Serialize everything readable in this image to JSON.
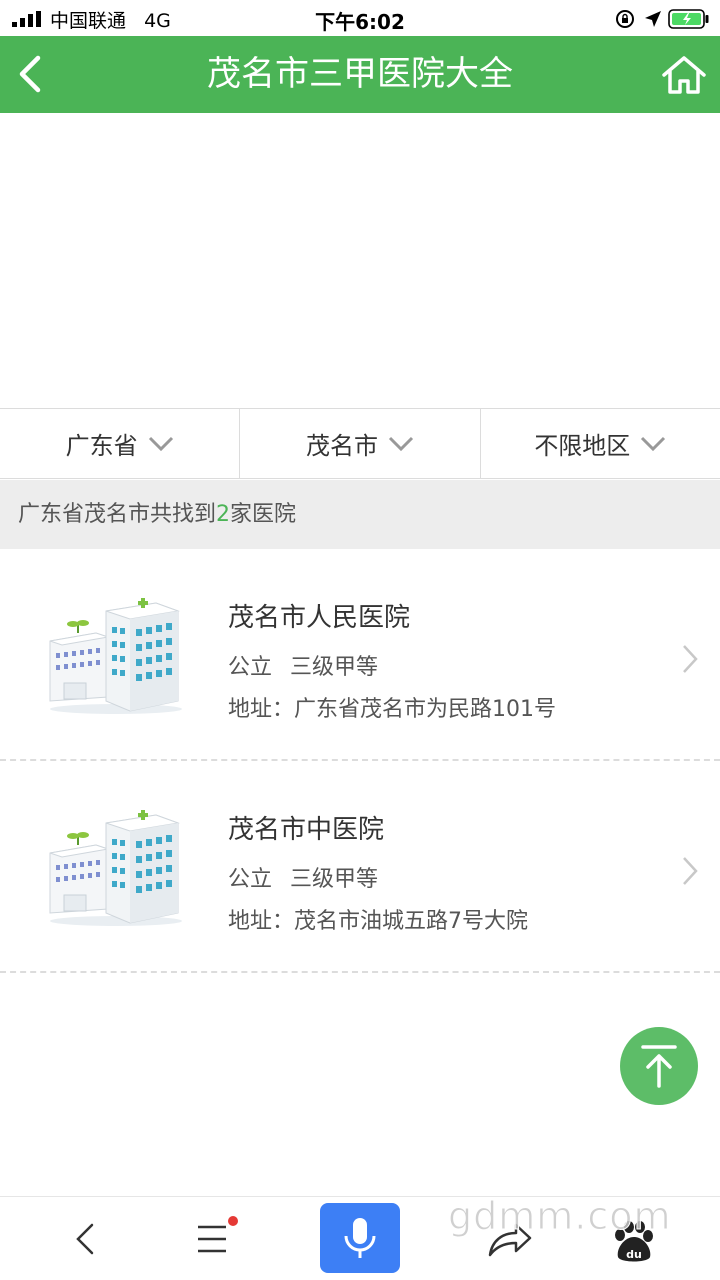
{
  "status_bar": {
    "carrier": "中国联通",
    "network": "4G",
    "time": "下午6:02"
  },
  "header": {
    "title": "茂名市三甲医院大全",
    "back_icon": "chevron-left-icon",
    "home_icon": "home-icon",
    "bg_color": "#4bb456"
  },
  "filters": [
    {
      "label": "广东省"
    },
    {
      "label": "茂名市"
    },
    {
      "label": "不限地区"
    }
  ],
  "summary": {
    "prefix": "广东省茂名市共找到",
    "count": "2",
    "suffix": "家医院"
  },
  "hospitals": [
    {
      "name": "茂名市人民医院",
      "type": "公立",
      "level": "三级甲等",
      "address": "地址：广东省茂名市为民路101号"
    },
    {
      "name": "茂名市中医院",
      "type": "公立",
      "level": "三级甲等",
      "address": "地址：茂名市油城五路7号大院"
    }
  ],
  "toolbar": {
    "icons": [
      "back-icon",
      "menu-icon",
      "microphone-icon",
      "share-icon",
      "baidu-icon"
    ]
  },
  "watermark": "gdmm.com"
}
